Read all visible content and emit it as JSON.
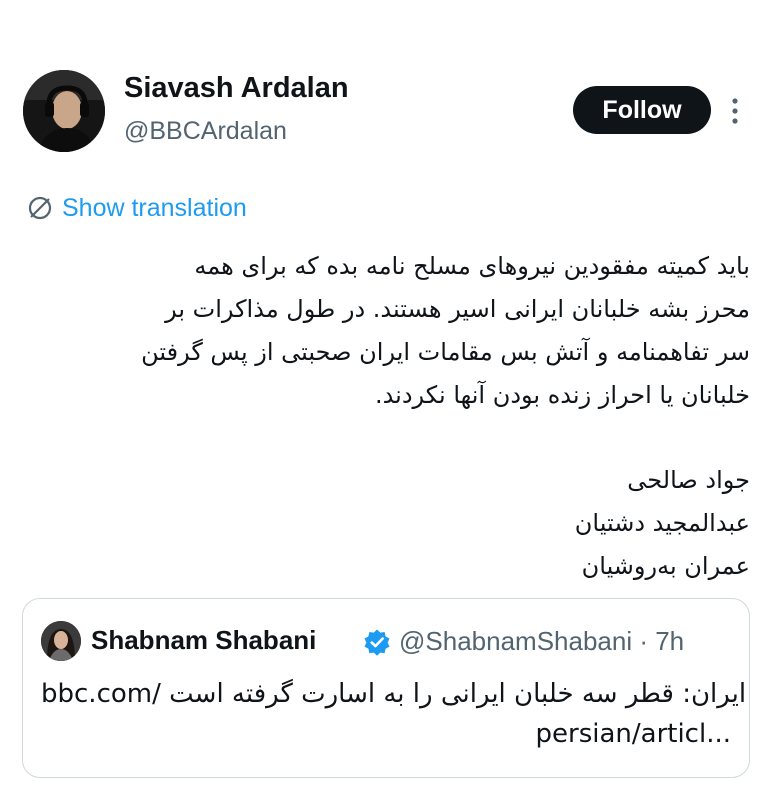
{
  "top_mark": "ʼ",
  "author": {
    "display_name": "Siavash Ardalan",
    "handle": "@BBCArdalan",
    "avatar_icon": "profile-photo-icon"
  },
  "actions": {
    "follow_label": "Follow",
    "more_icon": "more-vertical-icon"
  },
  "translation": {
    "label": "Show translation",
    "icon": "globe-translate-icon"
  },
  "tweet": {
    "lines": [
      "باید کمیته مفقودین نیروهای مسلح نامه بده که برای همه",
      "محرز بشه خلبانان ایرانی اسیر هستند.  در طول مذاکرات بر",
      "سر تفاهمنامه و آتش بس مقامات ایران صحبتی از پس گرفتن",
      "خلبانان یا احراز زنده بودن آنها نکردند."
    ],
    "names": [
      "جواد صالحی",
      "عبدالمجید دشتیان",
      "عمران به‌روشیان"
    ]
  },
  "quoted_tweet": {
    "display_name": "Shabnam Shabani",
    "handle_time": "@ShabnamShabani · 7h",
    "verified_icon": "verified-badge-icon",
    "line1_text": "ایران: قطر سه خلبان ایرانی را به اسارت گرفته است",
    "line1_link": "bbc.com/",
    "line2": "persian/articl..."
  },
  "colors": {
    "accent": "#1d9bf0",
    "text": "#0f1419",
    "secondary": "#536471",
    "follow_bg": "#0f1419",
    "border": "#cfd9de"
  }
}
